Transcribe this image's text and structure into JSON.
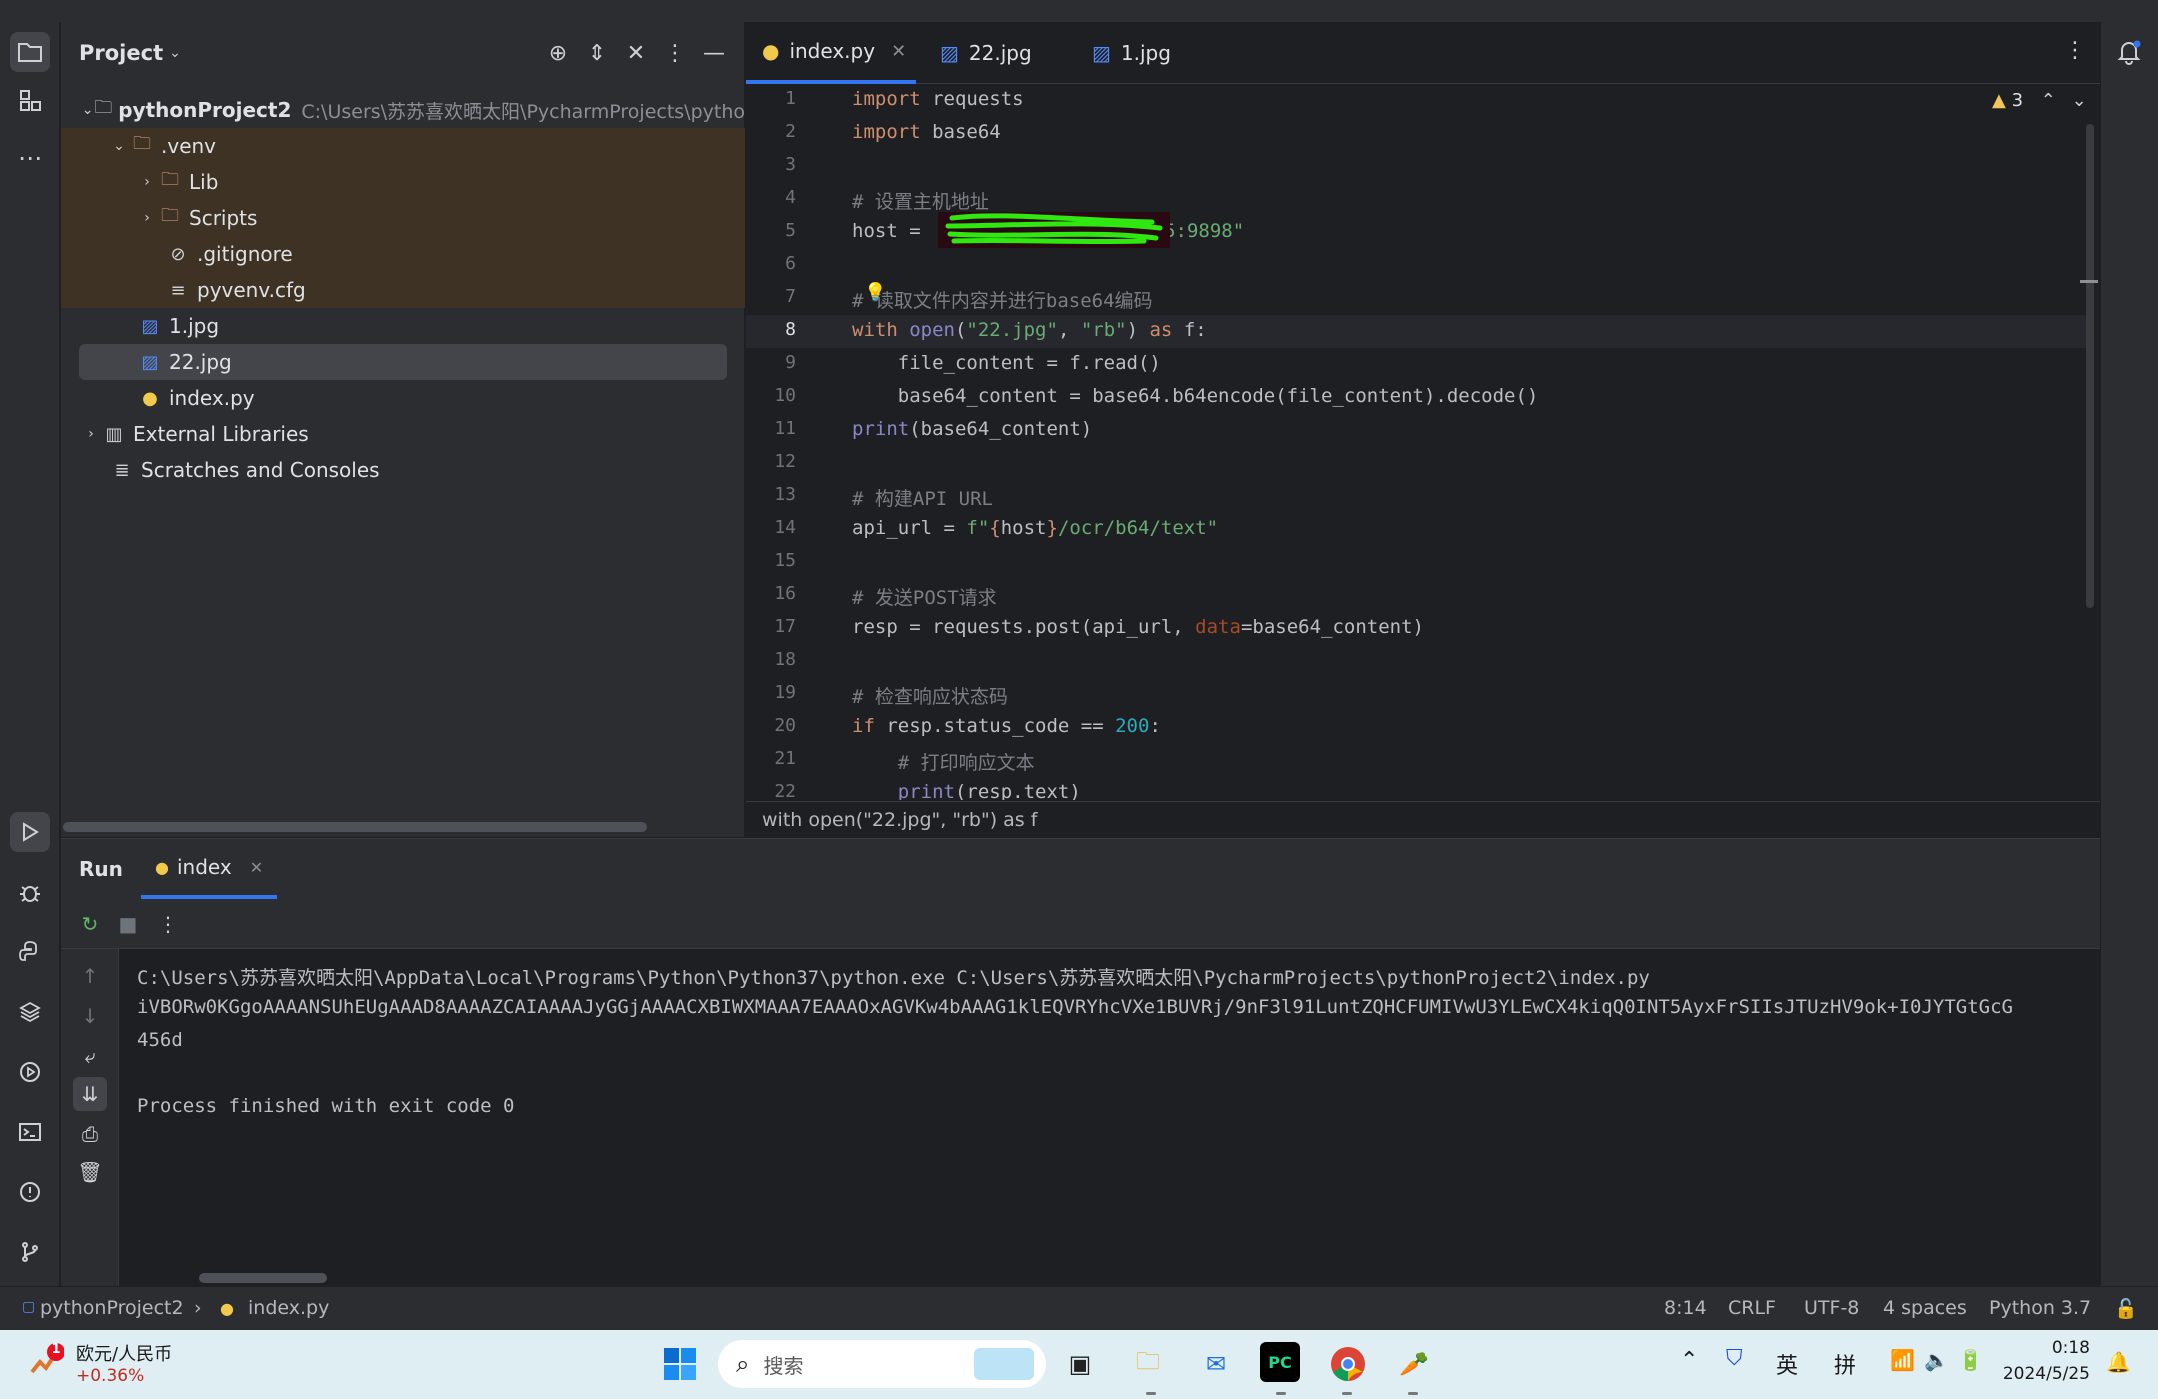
{
  "project_panel": {
    "title": "Project",
    "tree": [
      {
        "label": "pythonProject2",
        "path": "C:\\Users\\苏苏喜欢晒太阳\\PycharmProjects\\pytho"
      },
      {
        "label": ".venv"
      },
      {
        "label": "Lib"
      },
      {
        "label": "Scripts"
      },
      {
        "label": ".gitignore"
      },
      {
        "label": "pyvenv.cfg"
      },
      {
        "label": "1.jpg"
      },
      {
        "label": "22.jpg"
      },
      {
        "label": "index.py"
      },
      {
        "label": "External Libraries"
      },
      {
        "label": "Scratches and Consoles"
      }
    ]
  },
  "editor": {
    "tabs": [
      {
        "label": "index.py"
      },
      {
        "label": "22.jpg"
      },
      {
        "label": "1.jpg"
      }
    ],
    "warnings_count": "3",
    "line_numbers": [
      "1",
      "2",
      "3",
      "4",
      "5",
      "6",
      "7",
      "8",
      "9",
      "10",
      "11",
      "12",
      "13",
      "14",
      "15",
      "16",
      "17",
      "18",
      "19",
      "20",
      "21",
      "22"
    ],
    "breadcrumb": "with open(\"22.jpg\", \"rb\") as f",
    "code": {
      "l1_kw": "import",
      "l1_rest": " requests",
      "l2_kw": "import",
      "l2_rest": " base64",
      "l4": "# 设置主机地址",
      "l5_a": "host = ",
      "l5_b": "5:9898\"",
      "l7": "# 读取文件内容并进行base64编码",
      "l8_a": "with",
      "l8_b": " open",
      "l8_c": "(",
      "l8_d": "\"22.jpg\"",
      "l8_e": ", ",
      "l8_f": "\"rb\"",
      "l8_g": ") ",
      "l8_h": "as",
      "l8_i": " f:",
      "l9": "    file_content = f.read()",
      "l10": "    base64_content = base64.b64encode(file_content).decode()",
      "l11_a": "print",
      "l11_b": "(base64_content)",
      "l13": "# 构建API URL",
      "l14_a": "api_url = ",
      "l14_b": "f\"",
      "l14_c": "{",
      "l14_d": "host",
      "l14_e": "}",
      "l14_f": "/ocr/b64/text\"",
      "l16": "# 发送POST请求",
      "l17_a": "resp = requests.post(api_url, ",
      "l17_b": "data",
      "l17_c": "=base64_content)",
      "l19": "# 检查响应状态码",
      "l20_a": "if",
      "l20_b": " resp.status_code == ",
      "l20_c": "200",
      "l20_d": ":",
      "l21": "    # 打印响应文本",
      "l22_a": "    print",
      "l22_b": "(resp.text)"
    }
  },
  "run_panel": {
    "title": "Run",
    "tab_label": "index",
    "console": [
      "C:\\Users\\苏苏喜欢晒太阳\\AppData\\Local\\Programs\\Python\\Python37\\python.exe C:\\Users\\苏苏喜欢晒太阳\\PycharmProjects\\pythonProject2\\index.py",
      "iVBORw0KGgoAAAANSUhEUgAAAD8AAAAZCAIAAAAJyGGjAAAACXBIWXMAAA7EAAAOxAGVKw4bAAAG1klEQVRYhcVXe1BUVRj/9nF3l91LuntZQHCFUMIVwU3YLEwCX4kiqQ0INT5AyxFrSIIsJTUzHV9ok+I0JYTGtGcG",
      "456d",
      "",
      "Process finished with exit code 0"
    ]
  },
  "status_bar": {
    "project": "pythonProject2",
    "file": "index.py",
    "position": "8:14",
    "line_sep": "CRLF",
    "encoding": "UTF-8",
    "indent": "4 spaces",
    "interpreter": "Python 3.7"
  },
  "taskbar": {
    "widget_badge": "1",
    "widget_title": "欧元/人民币",
    "widget_value": "+0.36%",
    "search_placeholder": "搜索",
    "ime_lang": "英",
    "ime_mode": "拼",
    "time": "0:18",
    "date": "2024/5/25"
  },
  "colors": {
    "accent": "#3574f0",
    "excluded_bg": "#3d3223",
    "widget_value": "#c42b1c"
  }
}
